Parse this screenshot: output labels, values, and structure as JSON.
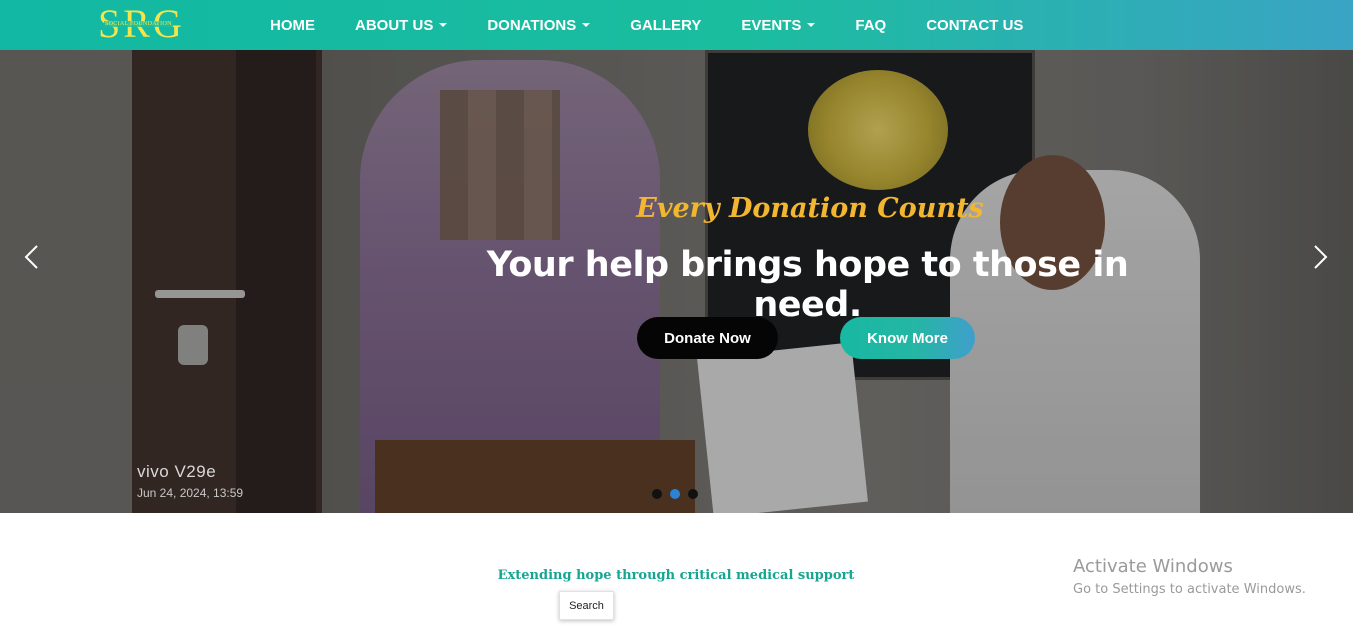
{
  "brand": {
    "logo_letters": "SRG",
    "logo_subtitle": "SOCIAL FOUNDATION",
    "logo_color": "#f4e64a"
  },
  "nav": {
    "items": [
      {
        "label": "HOME",
        "dropdown": false
      },
      {
        "label": "ABOUT US",
        "dropdown": true
      },
      {
        "label": "DONATIONS",
        "dropdown": true
      },
      {
        "label": "GALLERY",
        "dropdown": false
      },
      {
        "label": "EVENTS",
        "dropdown": true
      },
      {
        "label": "FAQ",
        "dropdown": false
      },
      {
        "label": "CONTACT US",
        "dropdown": false
      }
    ],
    "gradient_start": "#12b8a3",
    "gradient_end": "#3aa4c4"
  },
  "hero": {
    "tagline": "Every Donation Counts",
    "title": "Your help brings hope to those in need.",
    "primary_button": "Donate Now",
    "secondary_button": "Know More",
    "photo_watermark": "vivo V29e",
    "photo_timestamp": "Jun 24, 2024, 13:59",
    "prev_icon": "chevron-left-icon",
    "next_icon": "chevron-right-icon",
    "slide_count": 3,
    "active_slide": 2,
    "tagline_color": "#f2b630"
  },
  "content": {
    "subtitle": "Extending hope through critical medical support",
    "search_button": "Search"
  },
  "os_watermark": {
    "title": "Activate Windows",
    "subtitle": "Go to Settings to activate Windows."
  }
}
